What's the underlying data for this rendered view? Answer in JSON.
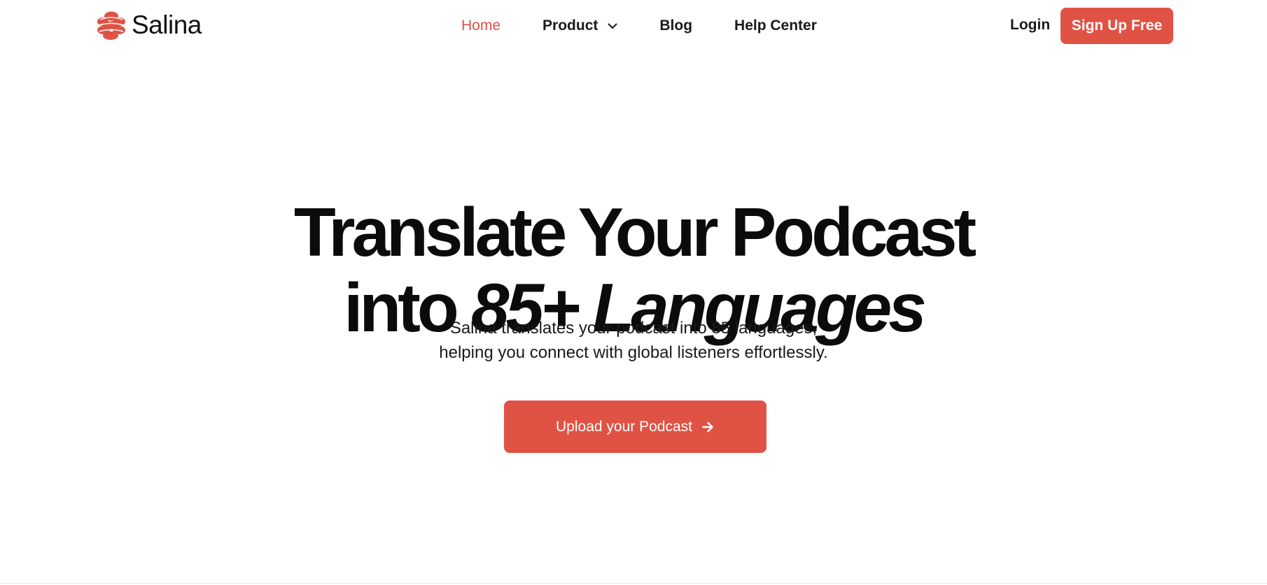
{
  "brand": {
    "name": "Salina",
    "accent_color": "#e05244",
    "logo_icon": "salina-logo-icon"
  },
  "nav": {
    "items": [
      {
        "label": "Home",
        "active": true
      },
      {
        "label": "Product",
        "has_dropdown": true,
        "dropdown_icon": "chevron-down-icon"
      },
      {
        "label": "Blog"
      },
      {
        "label": "Help Center"
      }
    ],
    "login_label": "Login",
    "signup_label": "Sign Up Free"
  },
  "hero": {
    "title_line1": "Translate Your Podcast",
    "title_line2_plain": "into",
    "title_line2_italic": "85+ Languages",
    "subtitle_line1": "Salina translates your podcast into 85 languages,",
    "subtitle_line2": "helping you connect with global listeners effortlessly.",
    "cta_label": "Upload your Podcast",
    "cta_icon": "arrow-right-icon"
  }
}
